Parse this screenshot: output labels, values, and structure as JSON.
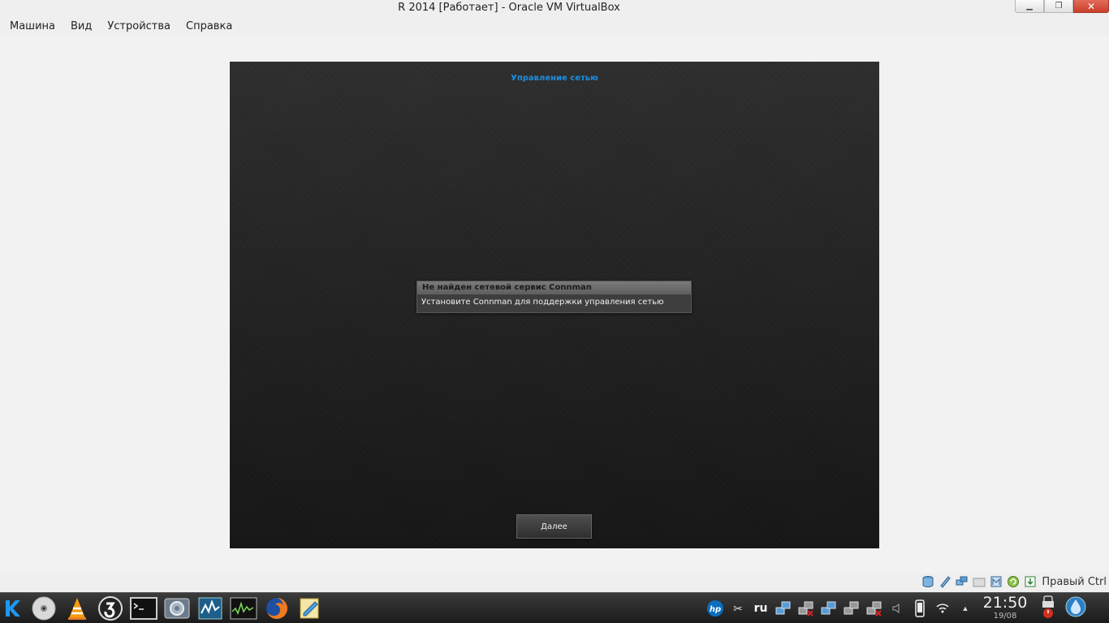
{
  "window": {
    "title": "R 2014 [Работает] - Oracle VM VirtualBox",
    "min_symbol": "▁",
    "max_symbol": "❐",
    "close_symbol": "✕"
  },
  "menu": [
    "Машина",
    "Вид",
    "Устройства",
    "Справка"
  ],
  "guest": {
    "header": "Управление сетью",
    "dialog_title": "Не найден сетевой сервис Connman",
    "dialog_message": "Установите Connman для поддержки управления сетью",
    "next_button": "Далее"
  },
  "vbox_status": {
    "icons": [
      "hard-disk-icon",
      "optical-drive-icon",
      "network-icon",
      "shared-folder-icon",
      "video-capture-icon",
      "mouse-integration-icon",
      "keyboard-capture-icon"
    ],
    "host_key": "Правый Ctrl"
  },
  "taskbar": {
    "launchers": [
      "kde-menu-icon",
      "disc-burner-icon",
      "vlc-icon",
      "system-update-icon",
      "terminal-icon",
      "settings-icon",
      "system-monitor-icon",
      "activity-graph-icon",
      "firefox-icon",
      "file-editor-icon"
    ],
    "keyboard_layout": "ru",
    "time": "21:50",
    "date": "19/08"
  },
  "colors": {
    "guest_header": "#1e8fe0",
    "close_button": "#c9402c",
    "taskbar": "#2a2a2a"
  }
}
